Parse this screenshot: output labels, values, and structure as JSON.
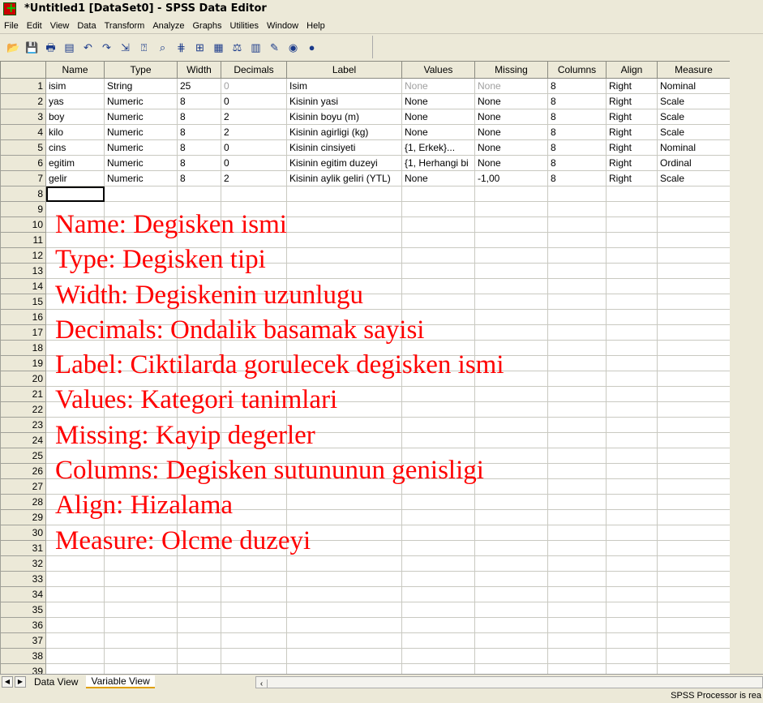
{
  "window": {
    "title": "*Untitled1 [DataSet0] - SPSS Data Editor"
  },
  "menu": [
    "File",
    "Edit",
    "View",
    "Data",
    "Transform",
    "Analyze",
    "Graphs",
    "Utilities",
    "Window",
    "Help"
  ],
  "toolbar": [
    {
      "icon": "open-folder-icon",
      "glyph": "📂"
    },
    {
      "icon": "save-icon",
      "glyph": "💾"
    },
    {
      "icon": "print-icon",
      "glyph": "🖶"
    },
    {
      "icon": "dialog-recall-icon",
      "glyph": "▤"
    },
    {
      "icon": "undo-icon",
      "glyph": "↶"
    },
    {
      "icon": "redo-icon",
      "glyph": "↷"
    },
    {
      "icon": "goto-case-icon",
      "glyph": "⇲"
    },
    {
      "icon": "variables-icon",
      "glyph": "⍰"
    },
    {
      "icon": "find-icon",
      "glyph": "⌕"
    },
    {
      "icon": "insert-cases-icon",
      "glyph": "⋕"
    },
    {
      "icon": "insert-variable-icon",
      "glyph": "⊞"
    },
    {
      "icon": "split-file-icon",
      "glyph": "▦"
    },
    {
      "icon": "weight-cases-icon",
      "glyph": "⚖"
    },
    {
      "icon": "select-cases-icon",
      "glyph": "▥"
    },
    {
      "icon": "value-labels-icon",
      "glyph": "✎"
    },
    {
      "icon": "use-sets-icon",
      "glyph": "◉"
    },
    {
      "icon": "show-all-variables-icon",
      "glyph": "●"
    }
  ],
  "columns": [
    "Name",
    "Type",
    "Width",
    "Decimals",
    "Label",
    "Values",
    "Missing",
    "Columns",
    "Align",
    "Measure"
  ],
  "rows": [
    [
      "isim",
      "String",
      "25",
      "0",
      "Isim",
      "None",
      "None",
      "8",
      "Right",
      "Nominal"
    ],
    [
      "yas",
      "Numeric",
      "8",
      "0",
      "Kisinin yasi",
      "None",
      "None",
      "8",
      "Right",
      "Scale"
    ],
    [
      "boy",
      "Numeric",
      "8",
      "2",
      "Kisinin boyu (m)",
      "None",
      "None",
      "8",
      "Right",
      "Scale"
    ],
    [
      "kilo",
      "Numeric",
      "8",
      "2",
      "Kisinin agirligi (kg)",
      "None",
      "None",
      "8",
      "Right",
      "Scale"
    ],
    [
      "cins",
      "Numeric",
      "8",
      "0",
      "Kisinin cinsiyeti",
      "{1, Erkek}...",
      "None",
      "8",
      "Right",
      "Nominal"
    ],
    [
      "egitim",
      "Numeric",
      "8",
      "0",
      "Kisinin egitim duzeyi",
      "{1, Herhangi bi",
      "None",
      "8",
      "Right",
      "Ordinal"
    ],
    [
      "gelir",
      "Numeric",
      "8",
      "2",
      "Kisinin aylik geliri (YTL)",
      "None",
      "-1,00",
      "8",
      "Right",
      "Scale"
    ]
  ],
  "total_rows": 39,
  "notes": [
    "Name: Degisken ismi",
    "Type: Degisken tipi",
    "Width: Degiskenin uzunlugu",
    "Decimals: Ondalik basamak sayisi",
    "Label: Ciktilarda gorulecek degisken ismi",
    "Values: Kategori tanimlari",
    "Missing: Kayip degerler",
    "Columns: Degisken sutununun genisligi",
    "Align: Hizalama",
    "Measure: Olcme duzeyi"
  ],
  "tabs": [
    "Data View",
    "Variable View"
  ],
  "active_tab": "Variable View",
  "status": "SPSS Processor is rea"
}
